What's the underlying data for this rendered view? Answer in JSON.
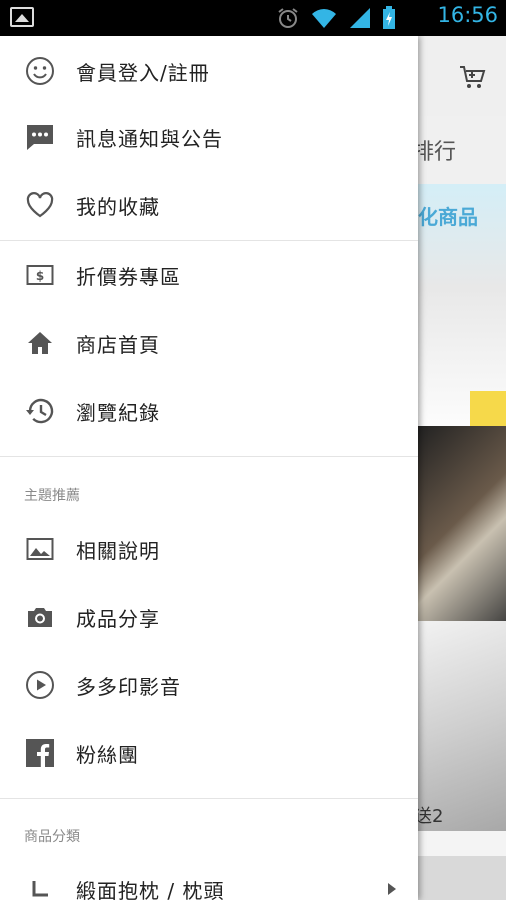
{
  "status_bar": {
    "time": "16:56"
  },
  "background": {
    "tab_text": "排行",
    "banner_text": "化商品",
    "product_caption": "送2"
  },
  "drawer": {
    "items_top": [
      {
        "label": "會員登入/註冊",
        "icon": "smiley-icon"
      },
      {
        "label": "訊息通知與公告",
        "icon": "message-icon"
      },
      {
        "label": "我的收藏",
        "icon": "heart-icon"
      }
    ],
    "items_mid": [
      {
        "label": "折價券專區",
        "icon": "coupon-icon"
      },
      {
        "label": "商店首頁",
        "icon": "home-icon"
      },
      {
        "label": "瀏覽紀錄",
        "icon": "history-icon"
      }
    ],
    "section_theme": "主題推薦",
    "items_theme": [
      {
        "label": "相關說明",
        "icon": "image-icon"
      },
      {
        "label": "成品分享",
        "icon": "camera-icon"
      },
      {
        "label": "多多印影音",
        "icon": "play-icon"
      },
      {
        "label": "粉絲團",
        "icon": "facebook-icon"
      }
    ],
    "section_category": "商品分類",
    "items_category": [
      {
        "label": "緞面抱枕 / 枕頭",
        "icon": "corner-icon"
      }
    ]
  }
}
